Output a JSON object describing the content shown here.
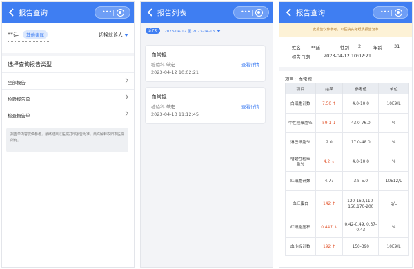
{
  "colors": {
    "primary": "#3f7ef2",
    "alert": "#e1552d",
    "warn_bg": "#fdf2d6"
  },
  "panel1": {
    "title": "报告查询",
    "patient_name": "**廷",
    "badge": "其他亲属",
    "switch_label": "切换就诊人",
    "section_title": "选择查询报告类型",
    "items": [
      "全部报告",
      "检验报告单",
      "检查报告单"
    ],
    "notice": "报告单内容仅供参考，最终结果以医院打印报告为准，最终解释权归本医院所有。"
  },
  "panel2": {
    "title": "报告列表",
    "chip": "近7天",
    "date_range": "2023-04-12 至 2023-04-13",
    "reports": [
      {
        "name": "血常规",
        "dept": "检验科 单宏",
        "time": "2023-04-12 10:02:21",
        "link": "查看详情"
      },
      {
        "name": "血常规",
        "dept": "检验科 单宏",
        "time": "2023-04-13 11:12:45",
        "link": "查看详情"
      }
    ]
  },
  "panel3": {
    "title": "报告查询",
    "warning": "此报告仅作参考，以医院实际纸质报告为准",
    "info": {
      "name_label": "姓名",
      "name": "**廷",
      "gender_label": "性别",
      "gender": "2",
      "age_label": "年龄",
      "age": "31",
      "date_label": "报告日期",
      "date": "2023-04-12 10:02:21"
    },
    "project": "项目：血常规",
    "headers": [
      "项目",
      "结果",
      "参考值",
      "单位"
    ],
    "rows": [
      {
        "item": "白细胞计数",
        "result": "7.50",
        "flag": "↑",
        "ref": "4.0-10.0",
        "unit": "10E9/L"
      },
      {
        "item": "中性粒细胞%",
        "result": "59.1",
        "flag": "↓",
        "ref": "43.0-76.0",
        "unit": "%"
      },
      {
        "item": "淋巴细胞%",
        "result": "2.0",
        "flag": "",
        "ref": "17.0-48.0",
        "unit": "%"
      },
      {
        "item": "嗜酸性粒细胞%",
        "result": "4.2",
        "flag": "↓",
        "ref": "4.0-10.0",
        "unit": "%"
      },
      {
        "item": "红细胞计数",
        "result": "4.77",
        "flag": "",
        "ref": "3.5-5.0",
        "unit": "10E12/L"
      },
      {
        "item": "血红蛋白",
        "result": "142",
        "flag": "↑",
        "ref": "120-160,110-150,170-200",
        "unit": "g/L"
      },
      {
        "item": "红细胞压积",
        "result": "0.447",
        "flag": "↓",
        "ref": "0.42-0.49, 0.37-0.43",
        "unit": "%"
      },
      {
        "item": "血小板计数",
        "result": "192",
        "flag": "↑",
        "ref": "150-390",
        "unit": "10E9/L"
      }
    ]
  }
}
